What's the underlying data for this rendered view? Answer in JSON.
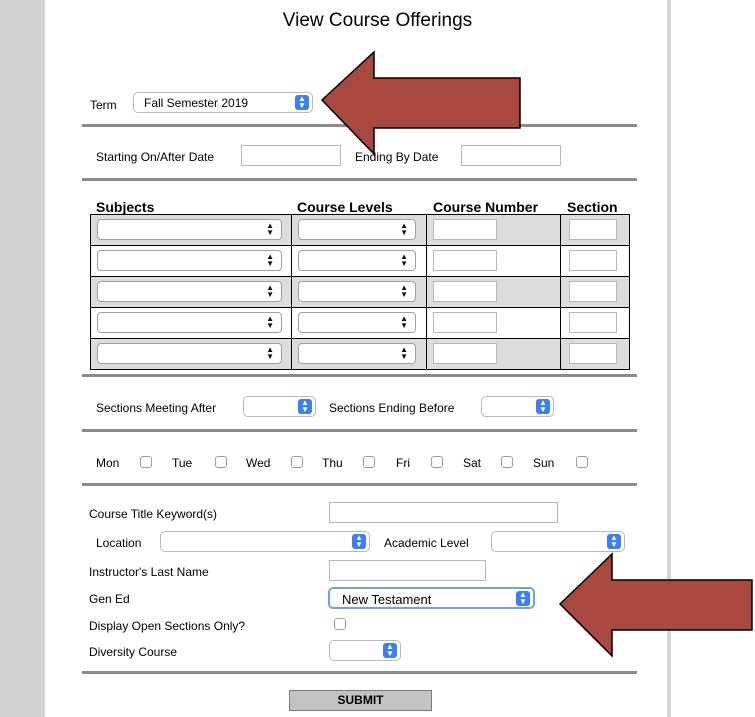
{
  "page": {
    "title": "View Course Offerings"
  },
  "term": {
    "label": "Term",
    "value": "Fall Semester 2019"
  },
  "dates": {
    "start_label": "Starting On/After Date",
    "end_label": "Ending By Date"
  },
  "table": {
    "headers": [
      "Subjects",
      "Course Levels",
      "Course Number",
      "Section"
    ],
    "row_count": 5
  },
  "times": {
    "after_label": "Sections Meeting After",
    "before_label": "Sections Ending Before"
  },
  "days": [
    "Mon",
    "Tue",
    "Wed",
    "Thu",
    "Fri",
    "Sat",
    "Sun"
  ],
  "filters": {
    "keyword_label": "Course Title Keyword(s)",
    "location_label": "Location",
    "academic_level_label": "Academic Level",
    "instructor_label": "Instructor's Last Name",
    "gen_ed_label": "Gen Ed",
    "gen_ed_value": "New Testament",
    "open_only_label": "Display Open Sections Only?",
    "diversity_label": "Diversity Course"
  },
  "submit": {
    "label": "SUBMIT"
  },
  "colors": {
    "arrow": "#a8483f",
    "select_accent": "#3b7ff5",
    "focus_ring": "#6fa0f0"
  }
}
